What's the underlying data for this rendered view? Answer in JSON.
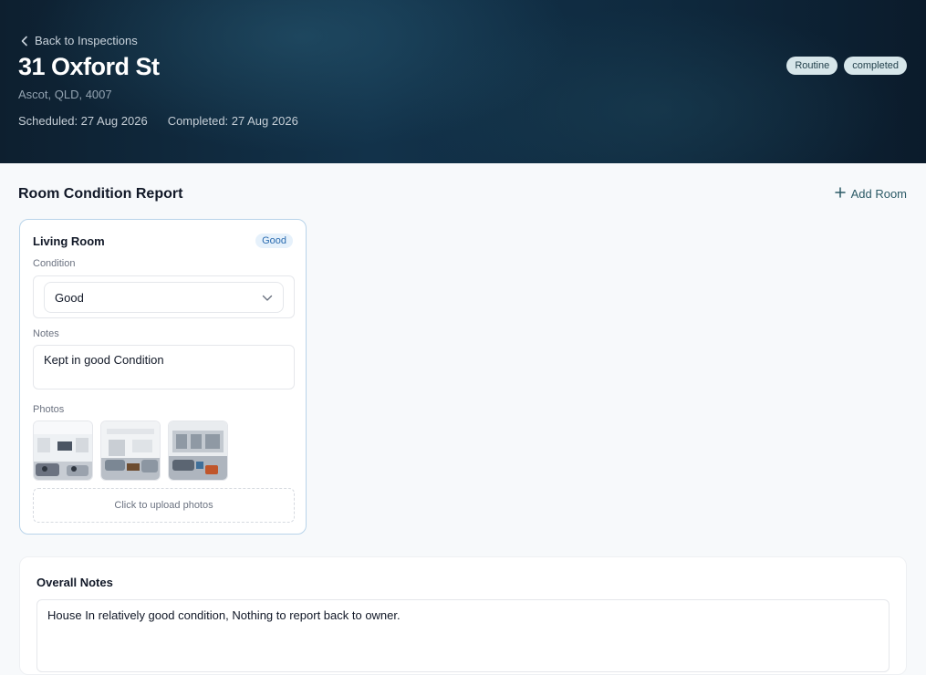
{
  "header": {
    "back_label": "Back to Inspections",
    "property_title": "31 Oxford St",
    "address": "Ascot, QLD, 4007",
    "scheduled": "Scheduled: 27 Aug 2026",
    "completed": "Completed: 27 Aug 2026",
    "badges": [
      "Routine",
      "completed"
    ]
  },
  "report": {
    "title": "Room Condition Report",
    "add_room_label": "Add Room"
  },
  "room": {
    "name": "Living Room",
    "condition_badge": "Good",
    "condition_label": "Condition",
    "condition_value": "Good",
    "notes_label": "Notes",
    "notes_value": "Kept in good Condition",
    "photos_label": "Photos",
    "photo_count": 3,
    "upload_label": "Click to upload photos"
  },
  "overall": {
    "title": "Overall Notes",
    "text": "House In relatively good condition, Nothing to report back to owner."
  },
  "icons": {
    "back": "chevron-left-icon",
    "add": "plus-icon",
    "dropdown": "chevron-down-icon"
  }
}
